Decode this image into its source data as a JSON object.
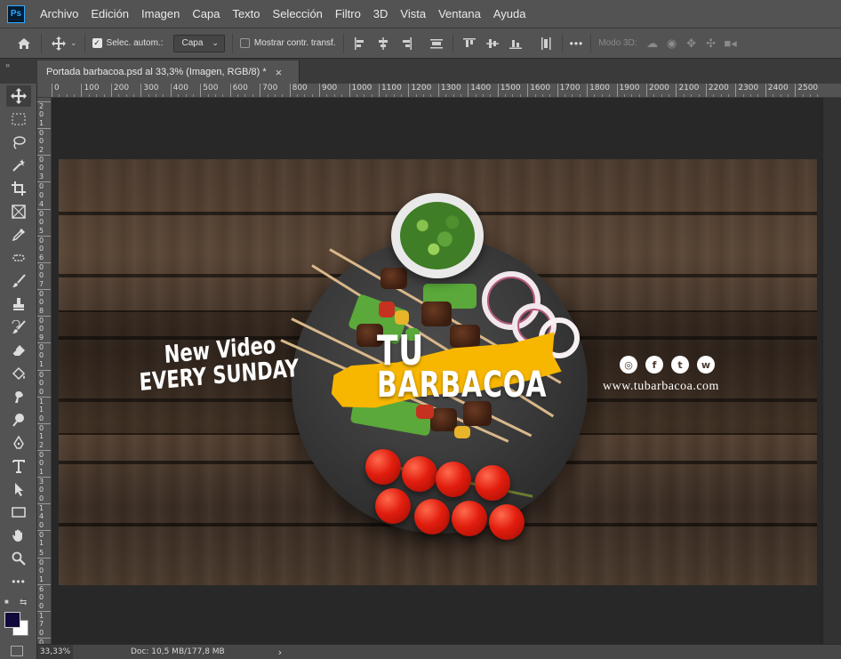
{
  "app": {
    "logo": "Ps"
  },
  "menu": [
    "Archivo",
    "Edición",
    "Imagen",
    "Capa",
    "Texto",
    "Selección",
    "Filtro",
    "3D",
    "Vista",
    "Ventana",
    "Ayuda"
  ],
  "options": {
    "auto_select_label": "Selec. autom.:",
    "auto_select_target": "Capa",
    "show_transform_label": "Mostrar contr. transf.",
    "more": "•••",
    "mode3d_label": "Modo 3D:"
  },
  "tab": {
    "title": "Portada barbacoa.psd al 33,3% (Imagen, RGB/8) *",
    "close": "×"
  },
  "collapse": "»",
  "ruler": {
    "top": [
      "0",
      "100",
      "200",
      "300",
      "400",
      "500",
      "600",
      "700",
      "800",
      "900",
      "1000",
      "1100",
      "1200",
      "1300",
      "1400",
      "1500",
      "1600",
      "1700",
      "1800",
      "1900",
      "2000",
      "2100",
      "2200",
      "2300",
      "2400",
      "2500"
    ],
    "left": [
      "2",
      "0",
      "1",
      "0",
      "0",
      "2",
      "0",
      "0",
      "3",
      "0",
      "0",
      "4",
      "0",
      "0",
      "5",
      "0",
      "0",
      "6",
      "0",
      "0",
      "7",
      "0",
      "0",
      "8",
      "0",
      "0",
      "9",
      "0",
      "0",
      "1",
      "0",
      "0",
      "0",
      "1",
      "1",
      "0",
      "0",
      "1",
      "2",
      "0",
      "0",
      "1",
      "3",
      "0",
      "0",
      "1",
      "4",
      "0",
      "0",
      "1",
      "5",
      "0",
      "0",
      "1",
      "6",
      "0",
      "0",
      "1",
      "7",
      "0",
      "0"
    ]
  },
  "artwork": {
    "line1": "New Video",
    "line2": "EVERY SUNDAY",
    "title1": "TU",
    "title2": "BARBACOA",
    "social": [
      "◎",
      "f",
      "t",
      "w"
    ],
    "website": "www.tubarbacoa.com"
  },
  "status": {
    "zoom": "33,33%",
    "doc": "Doc: 10,5 MB/177,8 MB",
    "arrow": "›"
  },
  "colors": {
    "foreground": "#10093a",
    "background": "#ffffff",
    "accent": "#f7b600"
  }
}
